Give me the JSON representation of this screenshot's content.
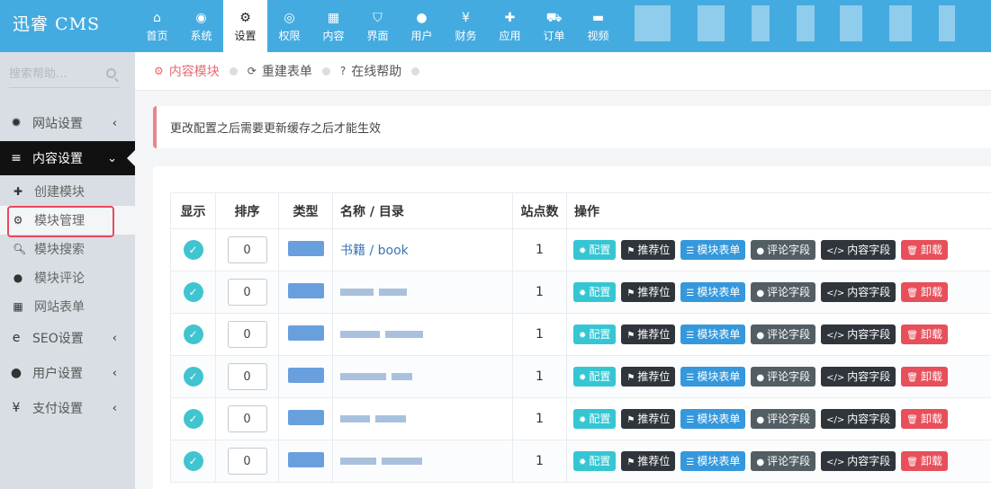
{
  "app": {
    "logo": "迅睿 CMS"
  },
  "topnav": [
    {
      "label": "首页",
      "icon": "home-icon",
      "glyph": "⌂"
    },
    {
      "label": "系统",
      "icon": "globe-icon",
      "glyph": "◉"
    },
    {
      "label": "设置",
      "icon": "cogs-icon",
      "glyph": "⚙",
      "active": true
    },
    {
      "label": "权限",
      "icon": "user-circle-icon",
      "glyph": "◎"
    },
    {
      "label": "内容",
      "icon": "th-large-icon",
      "glyph": "▦"
    },
    {
      "label": "界面",
      "icon": "html5-icon",
      "glyph": "⛉"
    },
    {
      "label": "用户",
      "icon": "user-icon",
      "glyph": "●"
    },
    {
      "label": "财务",
      "icon": "yen-icon",
      "glyph": "¥"
    },
    {
      "label": "应用",
      "icon": "puzzle-icon",
      "glyph": "✚"
    },
    {
      "label": "订单",
      "icon": "cart-icon",
      "glyph": "⛟"
    },
    {
      "label": "视频",
      "icon": "video-icon",
      "glyph": "▬"
    }
  ],
  "sidebar": {
    "search_placeholder": "搜索帮助...",
    "menu": [
      {
        "label": "网站设置",
        "glyph": "✹",
        "icon": "gear-icon",
        "caret": "‹"
      },
      {
        "label": "内容设置",
        "glyph": "≡",
        "icon": "bars-icon",
        "caret": "⌄",
        "open": true
      }
    ],
    "sub": [
      {
        "label": "创建模块",
        "glyph": "✚",
        "icon": "plus-icon"
      },
      {
        "label": "模块管理",
        "glyph": "⚙",
        "icon": "cogs-icon",
        "active": true
      },
      {
        "label": "模块搜索",
        "glyph": "🔍︎",
        "icon": "search-icon"
      },
      {
        "label": "模块评论",
        "glyph": "●",
        "icon": "comments-icon"
      },
      {
        "label": "网站表单",
        "glyph": "▦",
        "icon": "table-icon"
      }
    ],
    "menu2": [
      {
        "label": "SEO设置",
        "glyph": "e",
        "icon": "internet-explorer-icon",
        "caret": "‹"
      },
      {
        "label": "用户设置",
        "glyph": "●",
        "icon": "user-icon",
        "caret": "‹"
      },
      {
        "label": "支付设置",
        "glyph": "¥",
        "icon": "yen-icon",
        "caret": "‹"
      }
    ]
  },
  "breadcrumb": [
    {
      "label": "内容模块",
      "glyph": "⚙",
      "icon": "cogs-icon",
      "active": true
    },
    {
      "label": "重建表单",
      "glyph": "⟳",
      "icon": "refresh-icon"
    },
    {
      "label": "在线帮助",
      "glyph": "?",
      "icon": "question-circle-icon"
    }
  ],
  "notice": "更改配置之后需要更新缓存之后才能生效",
  "table": {
    "headers": [
      "显示",
      "排序",
      "类型",
      "名称 / 目录",
      "站点数",
      "操作"
    ],
    "rows": [
      {
        "order": "0",
        "name": "书籍 / book",
        "sites": "1"
      },
      {
        "order": "0",
        "name": "",
        "sites": "1"
      },
      {
        "order": "0",
        "name": "",
        "sites": "1"
      },
      {
        "order": "0",
        "name": "",
        "sites": "1"
      },
      {
        "order": "0",
        "name": "",
        "sites": "1"
      },
      {
        "order": "0",
        "name": "",
        "sites": "1"
      }
    ],
    "actions": [
      {
        "label": "配置",
        "glyph": "✹",
        "icon": "gear-icon",
        "cls": "b-config",
        "color": "#36c6d3"
      },
      {
        "label": "推荐位",
        "glyph": "⚑",
        "icon": "flag-icon",
        "cls": "b-rec",
        "color": "#2f353b"
      },
      {
        "label": "模块表单",
        "glyph": "☰",
        "icon": "list-icon",
        "cls": "b-form",
        "color": "#3598dc"
      },
      {
        "label": "评论字段",
        "glyph": "●",
        "icon": "comments-icon",
        "cls": "b-comment",
        "color": "#525e64"
      },
      {
        "label": "内容字段",
        "glyph": "</>",
        "icon": "code-icon",
        "cls": "b-field",
        "color": "#2f353b"
      },
      {
        "label": "卸载",
        "glyph": "🗑︎",
        "icon": "trash-icon",
        "cls": "b-del",
        "color": "#e7505a"
      }
    ]
  }
}
